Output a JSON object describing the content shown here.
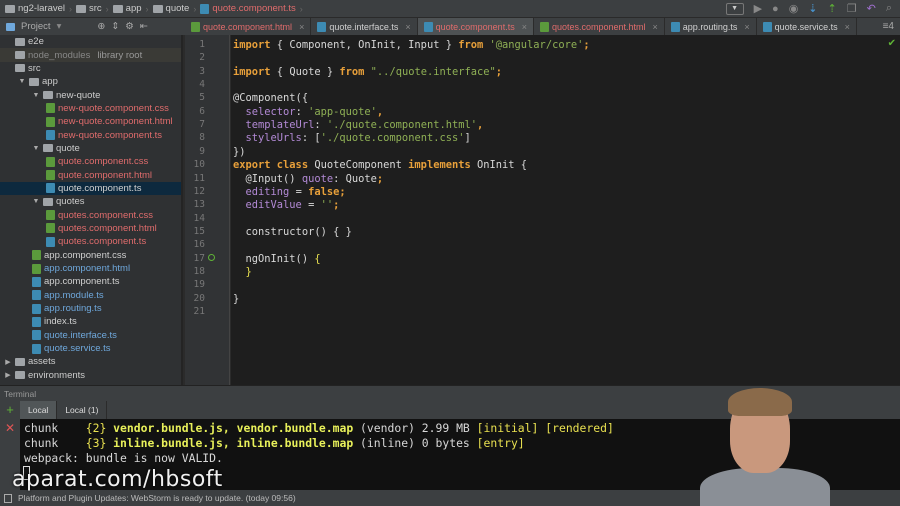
{
  "breadcrumb": [
    {
      "label": "ng2-laravel",
      "type": "folder"
    },
    {
      "label": "src",
      "type": "folder"
    },
    {
      "label": "app",
      "type": "folder"
    },
    {
      "label": "quote",
      "type": "folder"
    },
    {
      "label": "quote.component.ts",
      "type": "ts"
    }
  ],
  "project_panel": {
    "label": "Project"
  },
  "tabs": [
    {
      "label": "quote.component.html",
      "type": "html",
      "color": "red"
    },
    {
      "label": "quote.interface.ts",
      "type": "ts",
      "color": "white"
    },
    {
      "label": "quote.component.ts",
      "type": "ts",
      "color": "red",
      "active": true
    },
    {
      "label": "quotes.component.html",
      "type": "html",
      "color": "red"
    },
    {
      "label": "app.routing.ts",
      "type": "ts",
      "color": "white"
    },
    {
      "label": "quote.service.ts",
      "type": "ts",
      "color": "white"
    }
  ],
  "tabs_more": "≡4",
  "tree": [
    {
      "label": "e2e",
      "kind": "folder",
      "depth": 0
    },
    {
      "label": "node_modules",
      "kind": "folder",
      "depth": 0,
      "hint": "library root",
      "lib": true
    },
    {
      "label": "src",
      "kind": "folder",
      "depth": 0
    },
    {
      "label": "app",
      "kind": "folder",
      "depth": 1,
      "open": true
    },
    {
      "label": "new-quote",
      "kind": "folder",
      "depth": 2,
      "open": true
    },
    {
      "label": "new-quote.component.css",
      "kind": "css",
      "depth": 3,
      "color": "red"
    },
    {
      "label": "new-quote.component.html",
      "kind": "html",
      "depth": 3,
      "color": "red"
    },
    {
      "label": "new-quote.component.ts",
      "kind": "ts",
      "depth": 3,
      "color": "red"
    },
    {
      "label": "quote",
      "kind": "folder",
      "depth": 2,
      "open": true
    },
    {
      "label": "quote.component.css",
      "kind": "css",
      "depth": 3,
      "color": "red"
    },
    {
      "label": "quote.component.html",
      "kind": "html",
      "depth": 3,
      "color": "red"
    },
    {
      "label": "quote.component.ts",
      "kind": "ts",
      "depth": 3,
      "color": "white",
      "selected": true
    },
    {
      "label": "quotes",
      "kind": "folder",
      "depth": 2,
      "open": true
    },
    {
      "label": "quotes.component.css",
      "kind": "css",
      "depth": 3,
      "color": "red"
    },
    {
      "label": "quotes.component.html",
      "kind": "html",
      "depth": 3,
      "color": "red"
    },
    {
      "label": "quotes.component.ts",
      "kind": "ts",
      "depth": 3,
      "color": "red"
    },
    {
      "label": "app.component.css",
      "kind": "css",
      "depth": 2,
      "color": "white"
    },
    {
      "label": "app.component.html",
      "kind": "html",
      "depth": 2,
      "color": "blue"
    },
    {
      "label": "app.component.ts",
      "kind": "ts",
      "depth": 2,
      "color": "white"
    },
    {
      "label": "app.module.ts",
      "kind": "ts",
      "depth": 2,
      "color": "blue"
    },
    {
      "label": "app.routing.ts",
      "kind": "ts",
      "depth": 2,
      "color": "blue"
    },
    {
      "label": "index.ts",
      "kind": "ts",
      "depth": 2,
      "color": "white"
    },
    {
      "label": "quote.interface.ts",
      "kind": "ts",
      "depth": 2,
      "color": "blue"
    },
    {
      "label": "quote.service.ts",
      "kind": "ts",
      "depth": 2,
      "color": "blue"
    },
    {
      "label": "assets",
      "kind": "folder",
      "depth": 0,
      "closed": true
    },
    {
      "label": "environments",
      "kind": "folder",
      "depth": 0,
      "closed": true
    }
  ],
  "code": [
    [
      [
        "import",
        "kw"
      ],
      [
        " { Component, OnInit, Input } ",
        "pl"
      ],
      [
        "from",
        "kw"
      ],
      [
        " ",
        "pl"
      ],
      [
        "'@angular/core'",
        "str"
      ],
      [
        ";",
        "kw"
      ]
    ],
    [],
    [
      [
        "import",
        "kw"
      ],
      [
        " { Quote } ",
        "pl"
      ],
      [
        "from",
        "kw"
      ],
      [
        " ",
        "pl"
      ],
      [
        "\"../quote.interface\"",
        "str"
      ],
      [
        ";",
        "kw"
      ]
    ],
    [],
    [
      [
        "@Component({",
        "ann"
      ]
    ],
    [
      [
        "  ",
        "pl"
      ],
      [
        "selector",
        "fld"
      ],
      [
        ": ",
        "pl"
      ],
      [
        "'app-quote'",
        "str"
      ],
      [
        ",",
        "kw"
      ]
    ],
    [
      [
        "  ",
        "pl"
      ],
      [
        "templateUrl",
        "fld"
      ],
      [
        ": ",
        "pl"
      ],
      [
        "'./quote.component.html'",
        "str"
      ],
      [
        ",",
        "kw"
      ]
    ],
    [
      [
        "  ",
        "pl"
      ],
      [
        "styleUrls",
        "fld"
      ],
      [
        ": [",
        "pl"
      ],
      [
        "'./quote.component.css'",
        "str"
      ],
      [
        "]",
        "pl"
      ]
    ],
    [
      [
        "})",
        "pl"
      ]
    ],
    [
      [
        "export class",
        "kw"
      ],
      [
        " QuoteComponent ",
        "pl"
      ],
      [
        "implements",
        "kw"
      ],
      [
        " OnInit {",
        "pl"
      ]
    ],
    [
      [
        "  @Input() ",
        "pl"
      ],
      [
        "quote",
        "fld"
      ],
      [
        ": Quote",
        "pl"
      ],
      [
        ";",
        "kw"
      ]
    ],
    [
      [
        "  ",
        "pl"
      ],
      [
        "editing",
        "fld"
      ],
      [
        " = ",
        "pl"
      ],
      [
        "false",
        "kw"
      ],
      [
        ";",
        "kw"
      ]
    ],
    [
      [
        "  ",
        "pl"
      ],
      [
        "editValue",
        "fld"
      ],
      [
        " = ",
        "pl"
      ],
      [
        "''",
        "str"
      ],
      [
        ";",
        "kw"
      ]
    ],
    [],
    [
      [
        "  ",
        "pl"
      ],
      [
        "constructor",
        "pl"
      ],
      [
        "() { }",
        "pl"
      ]
    ],
    [],
    [
      [
        "  ngOnInit() ",
        "pl"
      ],
      [
        "{",
        "yw"
      ]
    ],
    [
      [
        "  ",
        "pl"
      ],
      [
        "}",
        "yw"
      ]
    ],
    [],
    [
      [
        "}",
        "pl"
      ]
    ],
    []
  ],
  "terminal": {
    "title": "Terminal",
    "tabs": [
      "Local",
      "Local (1)"
    ],
    "lines": [
      [
        [
          "chunk    ",
          "pl"
        ],
        [
          "{",
          "yw"
        ],
        [
          "2",
          "yw"
        ],
        [
          "} ",
          "yw"
        ],
        [
          "vendor.bundle.js, vendor.bundle.map",
          "yl"
        ],
        [
          " (vendor) 2.99 MB ",
          "pl"
        ],
        [
          "[initial]",
          "yw"
        ],
        [
          " ",
          "pl"
        ],
        [
          "[rendered]",
          "yw"
        ]
      ],
      [
        [
          "chunk    ",
          "pl"
        ],
        [
          "{",
          "yw"
        ],
        [
          "3",
          "yw"
        ],
        [
          "} ",
          "yw"
        ],
        [
          "inline.bundle.js, inline.bundle.map",
          "yl"
        ],
        [
          " (inline) 0 bytes ",
          "pl"
        ],
        [
          "[entry]",
          "yw"
        ]
      ],
      [
        [
          "webpack: bundle is now VALID.",
          "pl"
        ]
      ]
    ]
  },
  "status": "Platform and Plugin Updates: WebStorm is ready to update. (today 09:56)",
  "watermark": "aparat.com/hbsoft"
}
